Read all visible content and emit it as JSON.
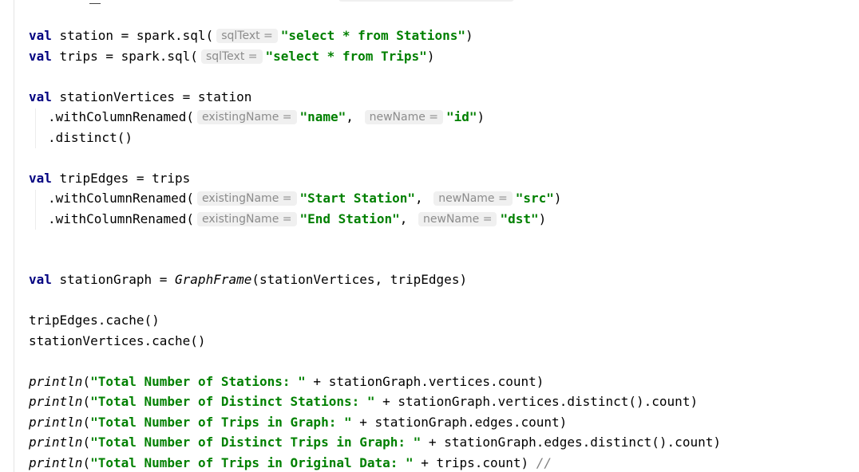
{
  "editor": {
    "lines": {
      "station": {
        "kw": "val",
        "before": " station = spark.sql(",
        "hint": "sqlText =",
        "str": "\"select * from Stations\"",
        "after": ")"
      },
      "trips": {
        "kw": "val",
        "before": " trips = spark.sql(",
        "hint": "sqlText =",
        "str": "\"select * from Trips\"",
        "after": ")"
      },
      "stationVertices": {
        "kw": "val",
        "rest": " stationVertices = station"
      },
      "rename_name": {
        "before": ".withColumnRenamed(",
        "hint1": "existingName =",
        "str1": "\"name\"",
        "comma": ",",
        "hint2": "newName =",
        "str2": "\"id\"",
        "after": ")"
      },
      "distinct": {
        "text": ".distinct()"
      },
      "tripEdges": {
        "kw": "val",
        "rest": " tripEdges = trips"
      },
      "rename_start": {
        "before": ".withColumnRenamed(",
        "hint1": "existingName =",
        "str1": "\"Start Station\"",
        "comma": ",",
        "hint2": "newName =",
        "str2": "\"src\"",
        "after": ")"
      },
      "rename_end": {
        "before": ".withColumnRenamed(",
        "hint1": "existingName =",
        "str1": "\"End Station\"",
        "comma": ",",
        "hint2": "newName =",
        "str2": "\"dst\"",
        "after": ")"
      },
      "stationGraph": {
        "kw": "val",
        "before": " stationGraph = ",
        "cls": "GraphFrame",
        "after": "(stationVertices, tripEdges)"
      },
      "cache_edges": {
        "text": "tripEdges.cache()"
      },
      "cache_vertices": {
        "text": "stationVertices.cache()"
      },
      "print1": {
        "fn": "println",
        "open": "(",
        "str": "\"Total Number of Stations: \"",
        "after": " + stationGraph.vertices.count)"
      },
      "print2": {
        "fn": "println",
        "open": "(",
        "str": "\"Total Number of Distinct Stations: \"",
        "after": " + stationGraph.vertices.distinct().count)"
      },
      "print3": {
        "fn": "println",
        "open": "(",
        "str": "\"Total Number of Trips in Graph: \"",
        "after": " + stationGraph.edges.count)"
      },
      "print4": {
        "fn": "println",
        "open": "(",
        "str": "\"Total Number of Distinct Trips in Graph: \"",
        "after": " + stationGraph.edges.distinct().count)"
      },
      "print5": {
        "fn": "println",
        "open": "(",
        "str": "\"Total Number of Trips in Original Data: \"",
        "after": " + trips.count)",
        "comment": "//"
      }
    }
  }
}
